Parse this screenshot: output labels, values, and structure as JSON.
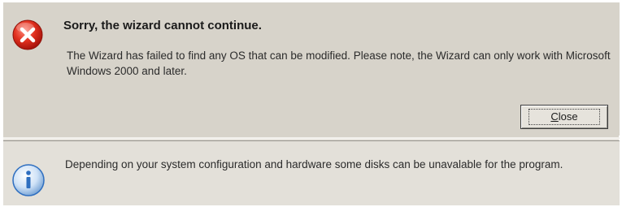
{
  "error": {
    "icon": "error-icon",
    "title": "Sorry, the wizard cannot continue.",
    "message": "The Wizard has failed to find any OS that can be modified. Please note, the Wizard can only work with Microsoft Windows 2000 and later.",
    "close_mnemonic": "C",
    "close_rest": "lose"
  },
  "info": {
    "icon": "info-icon",
    "message": "Depending on your system configuration and hardware some disks can be unavalable for the program."
  },
  "colors": {
    "panel_bg": "#d7d3ca",
    "error_red": "#d8261e",
    "info_blue": "#2f6fc0"
  }
}
